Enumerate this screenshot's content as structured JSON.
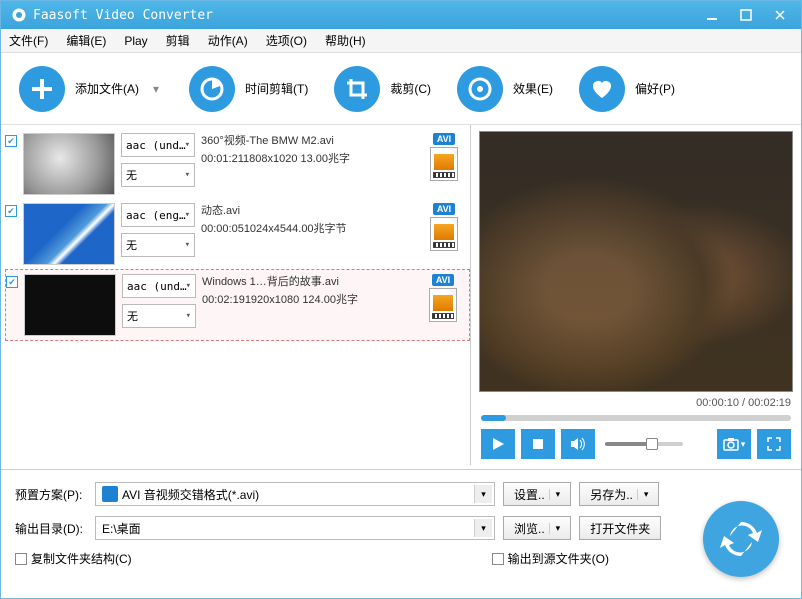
{
  "title": "Faasoft Video Converter",
  "menu": {
    "file": "文件(F)",
    "edit": "编辑(E)",
    "play": "Play",
    "cut": "剪辑",
    "action": "动作(A)",
    "option": "选项(O)",
    "help": "帮助(H)"
  },
  "toolbar": {
    "add": "添加文件(A)",
    "trim": "时间剪辑(T)",
    "crop": "裁剪(C)",
    "effect": "效果(E)",
    "pref": "偏好(P)"
  },
  "files": [
    {
      "audio": "aac (und…",
      "sub": "无",
      "name": "360°视频-The BMW M2.avi",
      "info": "00:01:211808x1020 13.00兆字",
      "fmt": "AVI"
    },
    {
      "audio": "aac (eng…",
      "sub": "无",
      "name": "动态.avi",
      "info": "00:00:051024x4544.00兆字节",
      "fmt": "AVI"
    },
    {
      "audio": "aac (und…",
      "sub": "无",
      "name": "Windows 1…背后的故事.avi",
      "info": "00:02:191920x1080 124.00兆字",
      "fmt": "AVI"
    }
  ],
  "preview": {
    "elapsed": "00:00:10",
    "total": "00:02:19",
    "sep": " / "
  },
  "preset": {
    "label": "预置方案(P):",
    "value": "AVI 音视频交错格式(*.avi)",
    "settings": "设置..",
    "saveas": "另存为.."
  },
  "output": {
    "label": "输出目录(D):",
    "value": "E:\\桌面",
    "browse": "浏览..",
    "open": "打开文件夹"
  },
  "opts": {
    "copy": "复制文件夹结构(C)",
    "outto": "输出到源文件夹(O)"
  }
}
